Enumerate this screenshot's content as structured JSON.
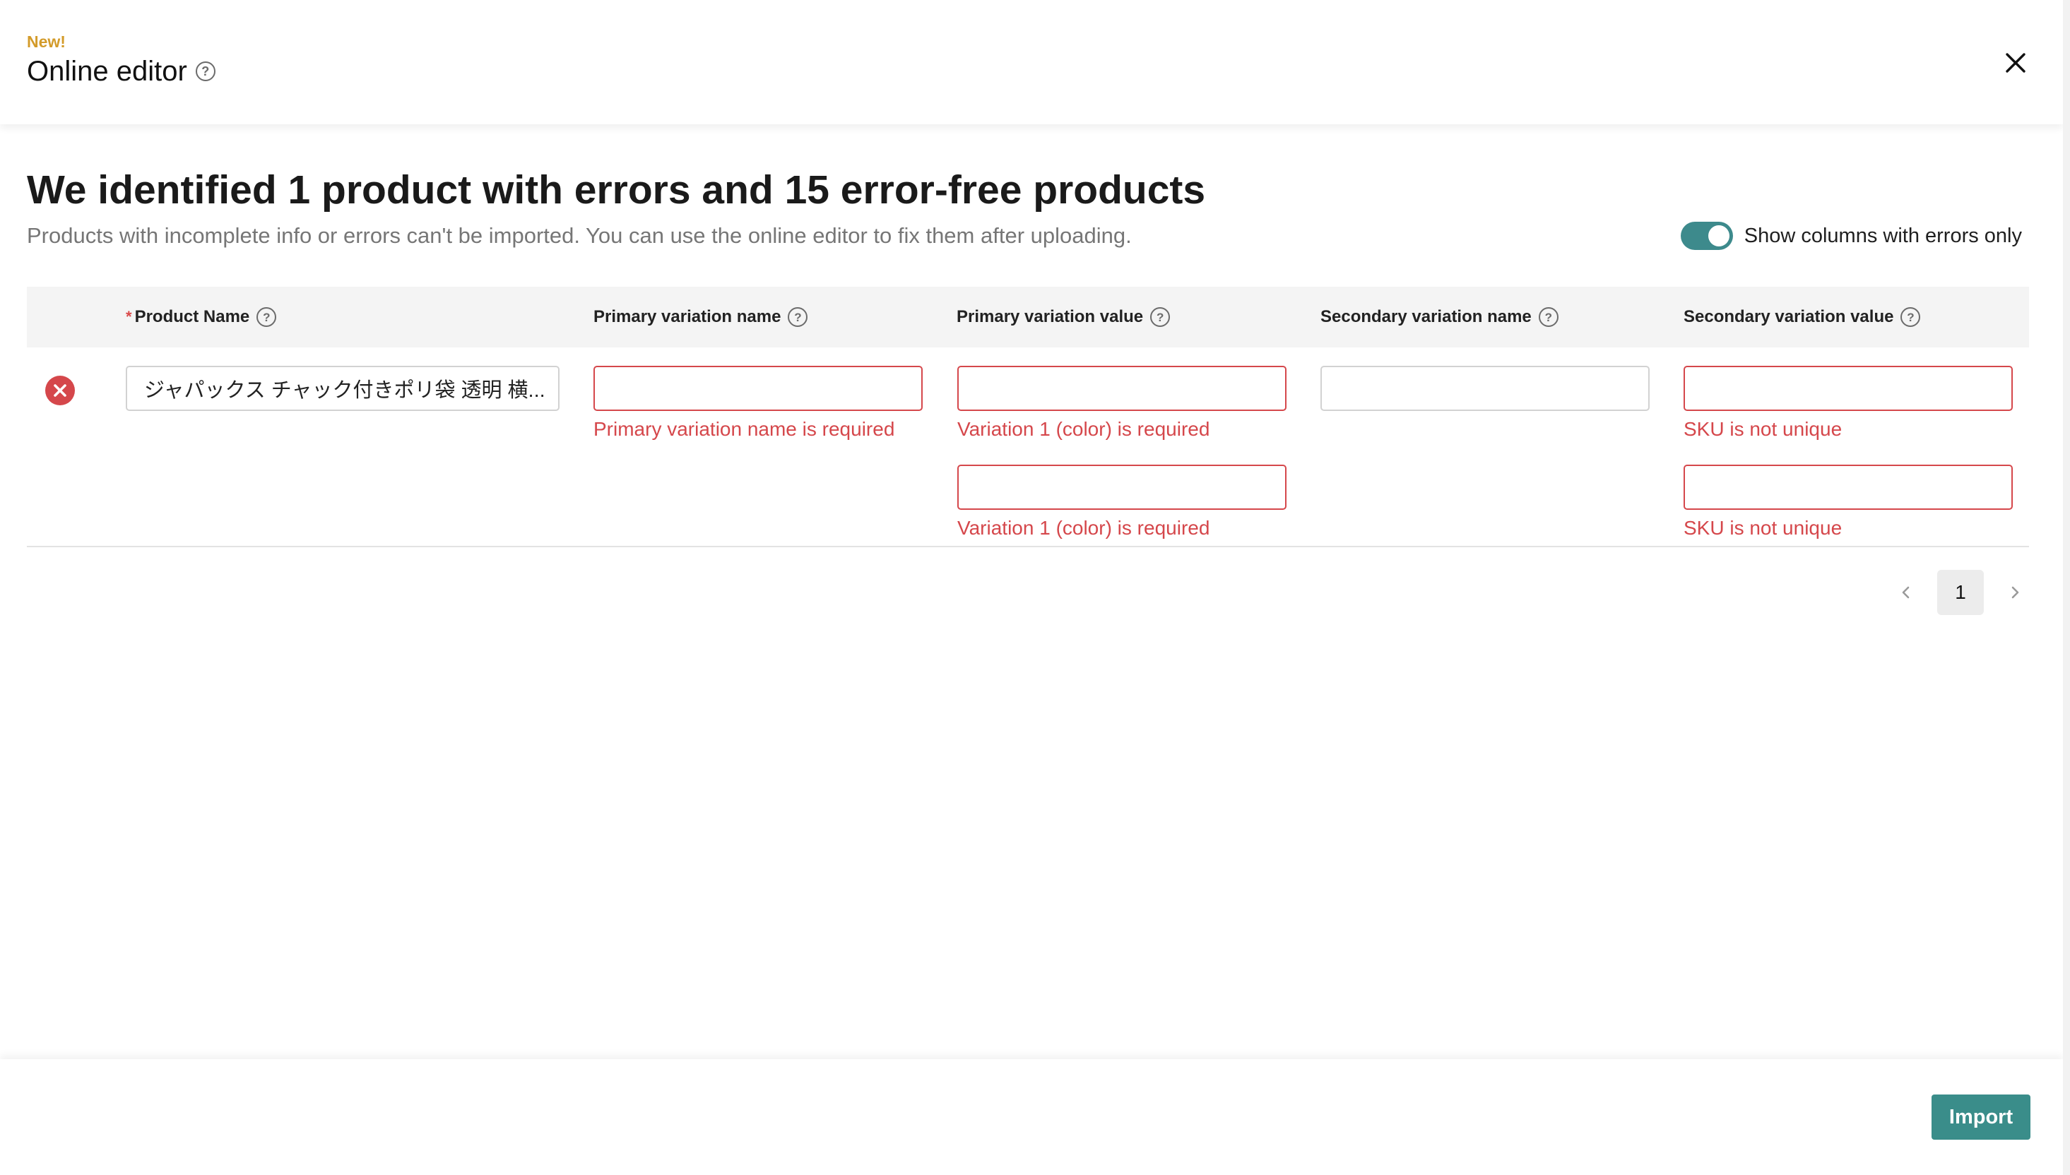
{
  "header": {
    "badge": "New!",
    "title": "Online editor",
    "help_icon": "question-circle-icon",
    "close_icon": "close-x-icon"
  },
  "summary": {
    "heading": "We identified 1 product with errors and 15 error-free products",
    "subheading": "Products with incomplete info or errors can't be imported. You can use the online editor to fix them after uploading."
  },
  "toggle": {
    "label": "Show columns with errors only",
    "checked": true
  },
  "table": {
    "columns": [
      {
        "label": "Product Name",
        "required_mark": "*"
      },
      {
        "label": "Primary variation name"
      },
      {
        "label": "Primary variation value"
      },
      {
        "label": "Secondary variation name"
      },
      {
        "label": "Secondary variation value"
      }
    ],
    "row": {
      "status_icon": "error-x-circle-icon",
      "product_name": "ジャパックス チャック付きポリ袋 透明 横...",
      "primary_variation_name": {
        "value": "",
        "error": "Primary variation name is required"
      },
      "primary_variation_values": [
        {
          "value": "",
          "error": "Variation 1 (color) is required"
        },
        {
          "value": "",
          "error": "Variation 1 (color) is required"
        }
      ],
      "secondary_variation_name": {
        "value": ""
      },
      "secondary_variation_values": [
        {
          "value": "",
          "error": "SKU is not unique"
        },
        {
          "value": "",
          "error": "SKU is not unique"
        }
      ]
    }
  },
  "pagination": {
    "current_page": "1",
    "prev_icon": "chevron-left-icon",
    "next_icon": "chevron-right-icon"
  },
  "footer": {
    "import_label": "Import"
  },
  "colors": {
    "accent": "#3a8d8a",
    "error": "#d5474b",
    "badge": "#d39b2a"
  }
}
